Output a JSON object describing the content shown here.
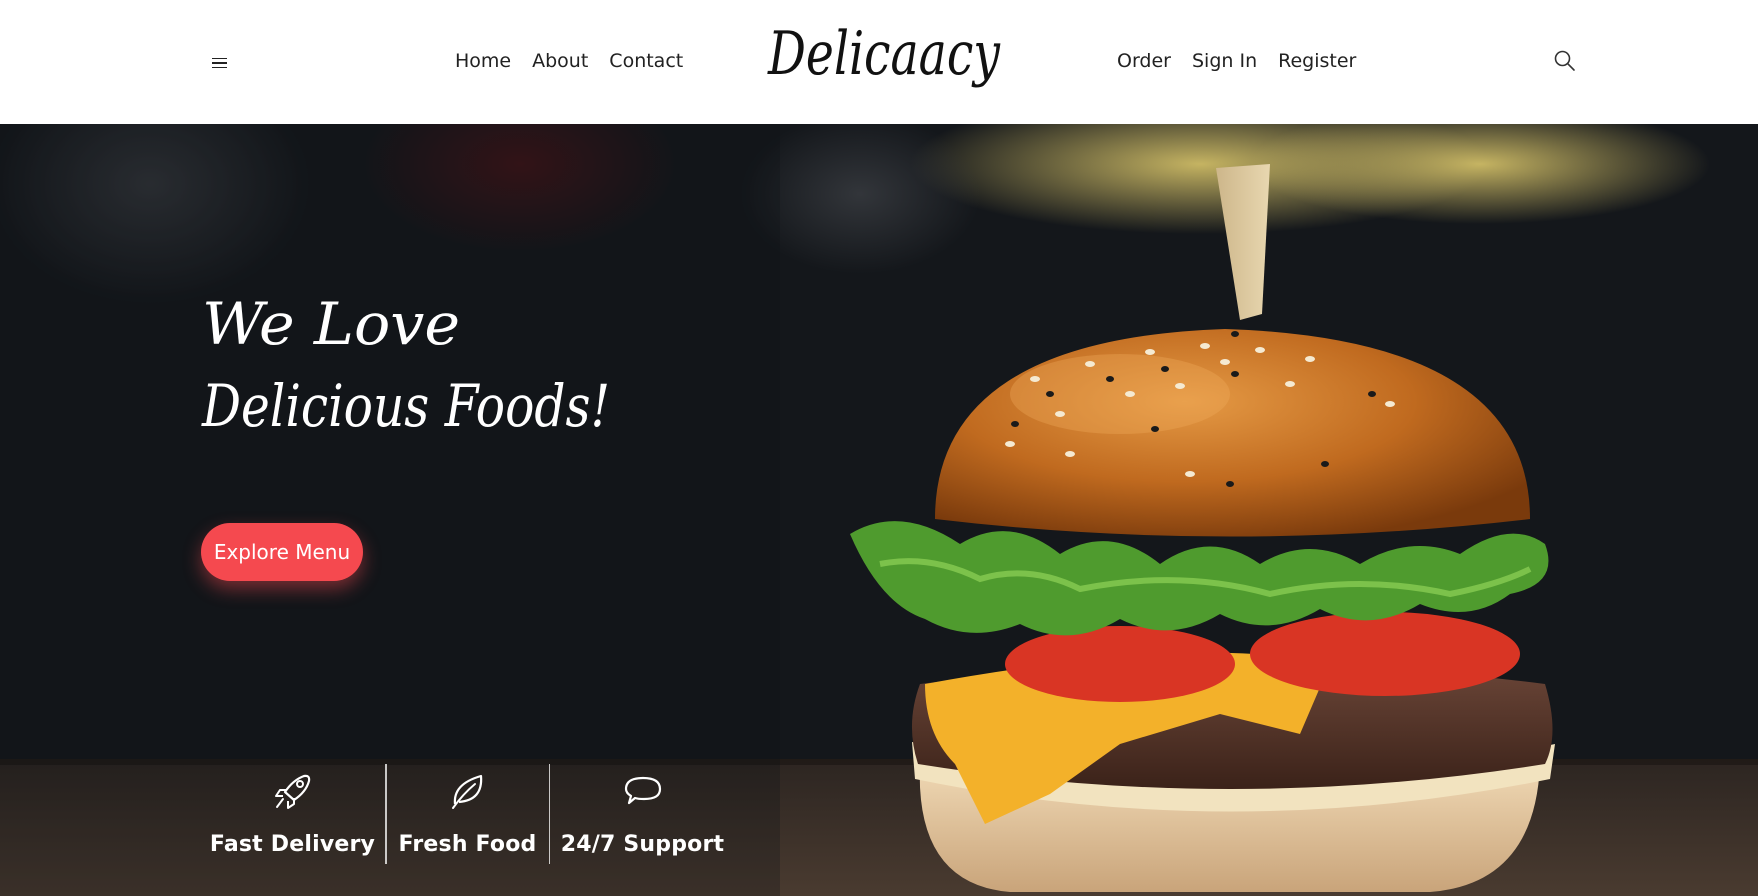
{
  "header": {
    "nav_left": [
      "Home",
      "About",
      "Contact"
    ],
    "brand": "Delicaacy",
    "nav_right": [
      "Order",
      "Sign In",
      "Register"
    ]
  },
  "hero": {
    "title_line1": "We Love",
    "title_line2": "Delicious Foods!",
    "cta_label": "Explore Menu"
  },
  "features": [
    {
      "icon": "rocket-icon",
      "label": "Fast Delivery"
    },
    {
      "icon": "leaf-icon",
      "label": "Fresh Food"
    },
    {
      "icon": "chat-bubble-icon",
      "label": "24/7 Support"
    }
  ],
  "colors": {
    "accent": "#f5494f",
    "hero_bg": "#121417",
    "header_bg": "#ffffff",
    "text_dark": "#222222"
  }
}
